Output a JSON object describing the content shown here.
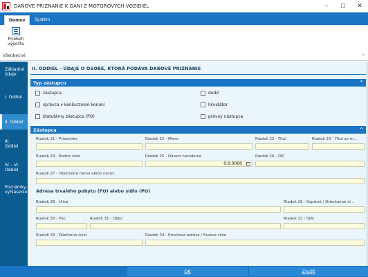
{
  "window": {
    "title": "DAŇOVÉ PRIZNANIE K DANI Z MOTOROVÝCH VOZIDIEL",
    "controls": {
      "minimize": "–",
      "maximize": "☐",
      "close": "✕"
    }
  },
  "ribbon": {
    "tabs": [
      {
        "label": "Domov"
      },
      {
        "label": "Systém"
      }
    ],
    "button": {
      "label_line1": "Priebeh",
      "label_line2": "výpočtu"
    },
    "group_label": "Všeobecné",
    "collapse_icon": "^"
  },
  "sidebar": {
    "items": [
      {
        "label_line1": "Základné",
        "label_line2": "údaje"
      },
      {
        "label_line1": "I. Oddiel",
        "label_line2": ""
      },
      {
        "label_line1": "II. Oddiel",
        "label_line2": ""
      },
      {
        "label_line1": "III.",
        "label_line2": "Oddiel"
      },
      {
        "label_line1": "IV. - VI.",
        "label_line2": "Oddiel"
      },
      {
        "label_line1": "Poznámky,",
        "label_line2": "vyhlásenie"
      }
    ]
  },
  "main": {
    "title": "II. ODDIEL - ÚDAJE O OSOBE, KTORÁ PODÁVA DAŇOVÉ PRIZNANIE",
    "typ_zastupcu": {
      "header": "Typ zástupcu",
      "options": [
        {
          "label": "zástupca"
        },
        {
          "label": "správca v konkurznom konaní"
        },
        {
          "label": "štatutárny zástupca (PO)"
        },
        {
          "label": "dedič"
        },
        {
          "label": "likvidátor"
        },
        {
          "label": "právny nástupca"
        }
      ]
    },
    "zastupca": {
      "header": "Zástupca",
      "fields": {
        "r21": "Riadok 21 - Priezvisko",
        "r22": "Riadok 22 - Meno",
        "r23": "Riadok 23 - Titul",
        "r23b": "Riadok 23 - Titul za m...",
        "r24": "Riadok 24 - Rodné číslo",
        "r25": "Riadok 25 - Dátum narodenia",
        "r25_value": "0.0.0000",
        "r26": "Riadok 26 - DIČ",
        "r27": "Riadok 27 - Obchodné meno alebo názov"
      },
      "address_title": "Adresa trvalého pobytu (FO) alebo sídlo (PO)",
      "address_fields": {
        "r28": "Riadok 28 - Ulica",
        "r29": "Riadok 29 - Súpisné / Orientačné čí...",
        "r30": "Riadok 30 - PSČ",
        "r31": "Riadok 31 - Obec",
        "r32": "Riadok 32 - Štát",
        "r33": "Riadok 33 - Telefónne číslo",
        "r34": "Riadok 34 - Emailová adresa / Faxové číslo"
      }
    }
  },
  "footer": {
    "ok": "OK",
    "cancel": "Zrušiť"
  }
}
